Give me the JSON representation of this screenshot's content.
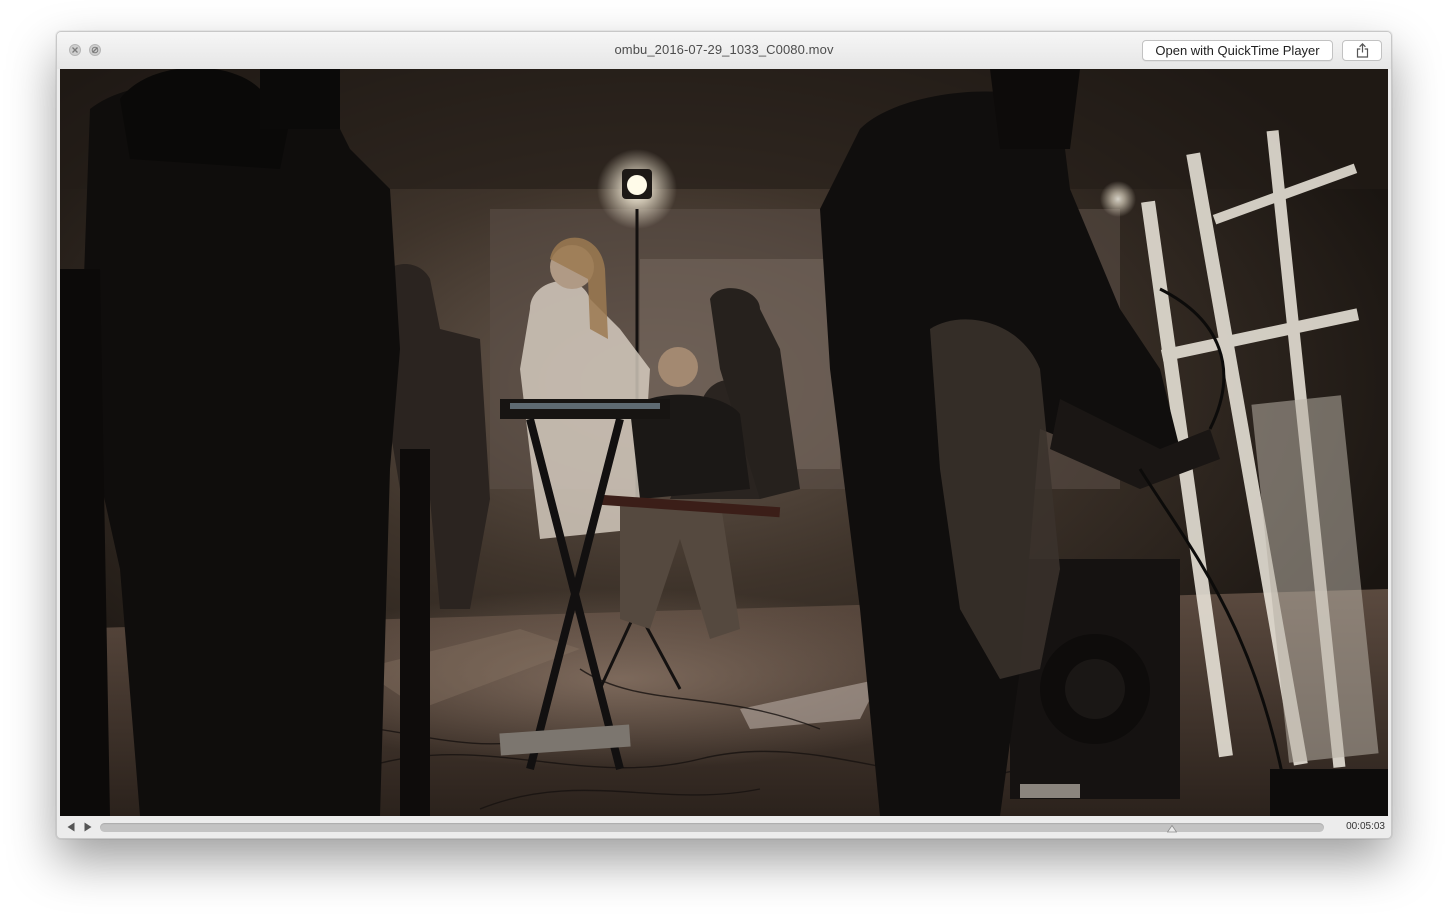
{
  "window": {
    "title": "ombu_2016-07-29_1033_C0080.mov"
  },
  "toolbar": {
    "open_label": "Open with QuickTime Player"
  },
  "icons": {
    "close": "close-icon",
    "minimize": "minimize-icon",
    "share": "share-icon",
    "previous": "previous-frame-icon",
    "play": "play-icon"
  },
  "playback": {
    "elapsed": "00:05:03",
    "progress": 0.876
  }
}
